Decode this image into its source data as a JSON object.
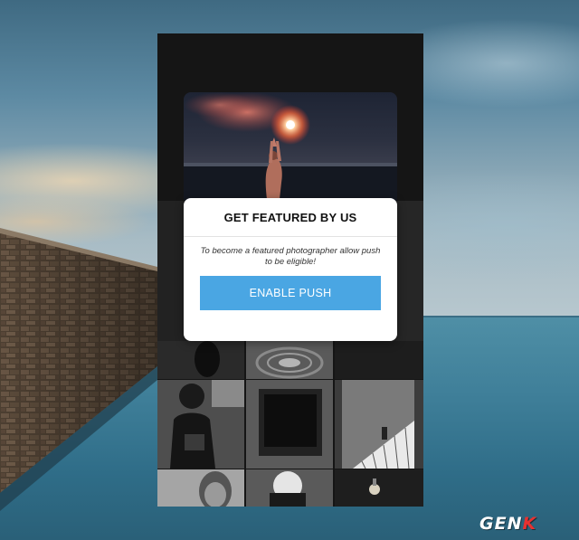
{
  "modal": {
    "title": "GET FEATURED BY US",
    "message": "To become a featured photographer allow push to be eligible!",
    "button_label": "ENABLE PUSH"
  },
  "watermark": {
    "text_main": "GEN",
    "text_accent": "K"
  },
  "colors": {
    "button": "#4aa6e3",
    "panel": "#151515",
    "watermark_accent": "#e8312f"
  }
}
